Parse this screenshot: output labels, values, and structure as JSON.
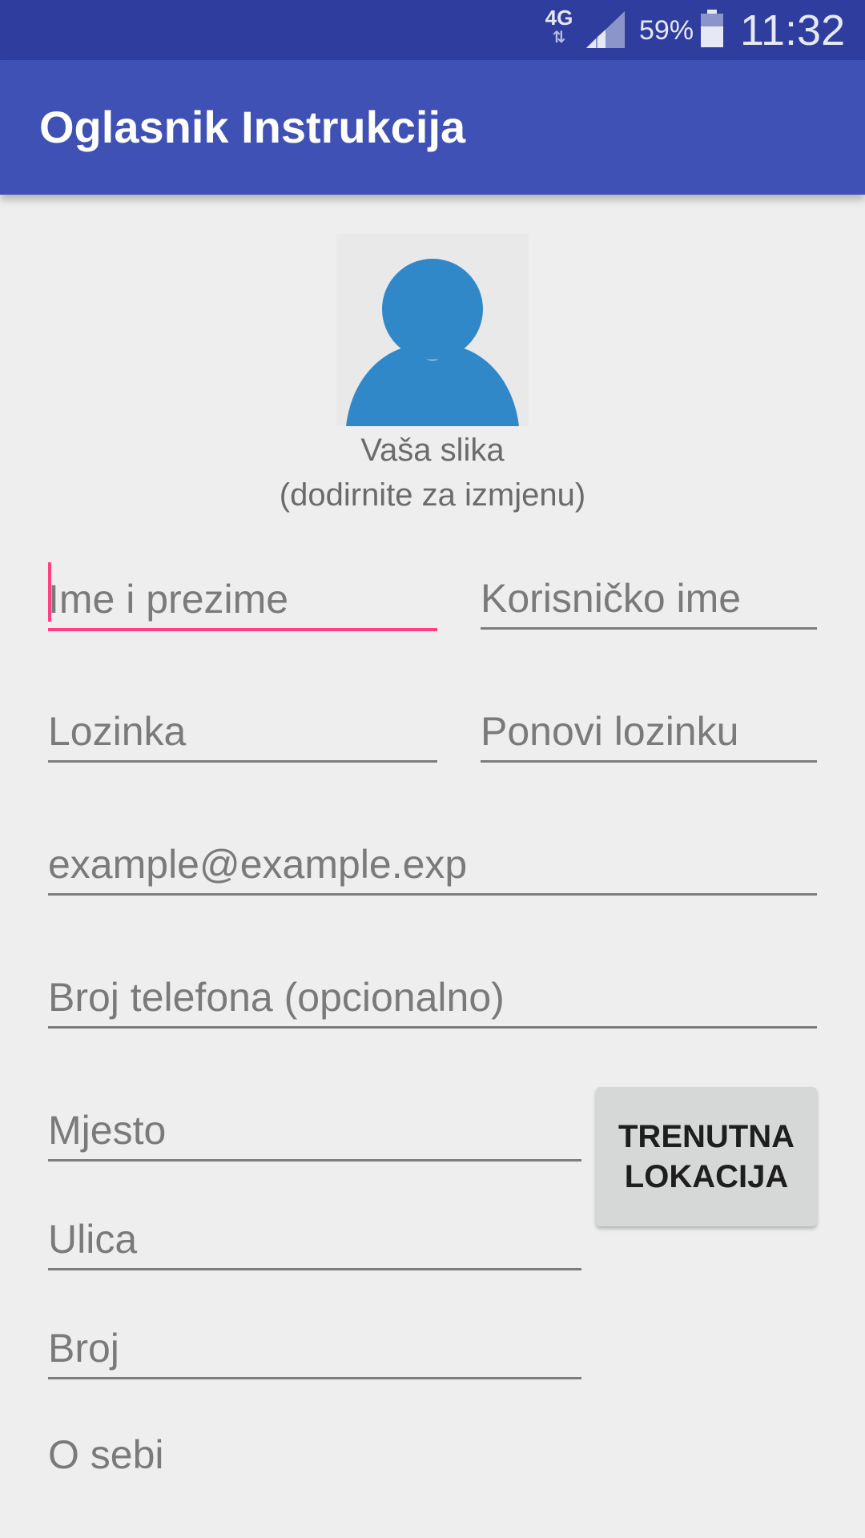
{
  "status_bar": {
    "network": "4G",
    "battery_percent": "59%",
    "time": "11:32",
    "icons": [
      "data-arrows-icon",
      "signal-icon",
      "battery-icon"
    ]
  },
  "app_bar": {
    "title": "Oglasnik Instrukcija"
  },
  "avatar": {
    "icon": "person-icon",
    "caption_line1": "Vaša slika",
    "caption_line2": "(dodirnite za izmjenu)",
    "color": "#3188c8"
  },
  "form": {
    "full_name_placeholder": "Ime i prezime",
    "username_placeholder": "Korisničko ime",
    "password_placeholder": "Lozinka",
    "repeat_password_placeholder": "Ponovi lozinku",
    "email_placeholder": "example@example.exp",
    "phone_placeholder": "Broj telefona (opcionalno)",
    "city_placeholder": "Mjesto",
    "street_placeholder": "Ulica",
    "number_placeholder": "Broj",
    "about_label": "O sebi",
    "current_location_button": "TRENUTNA LOKACIJA"
  },
  "colors": {
    "status_bar": "#2f3e9e",
    "app_bar": "#3f51b5",
    "accent": "#ff4081",
    "background": "#eeeeee"
  }
}
